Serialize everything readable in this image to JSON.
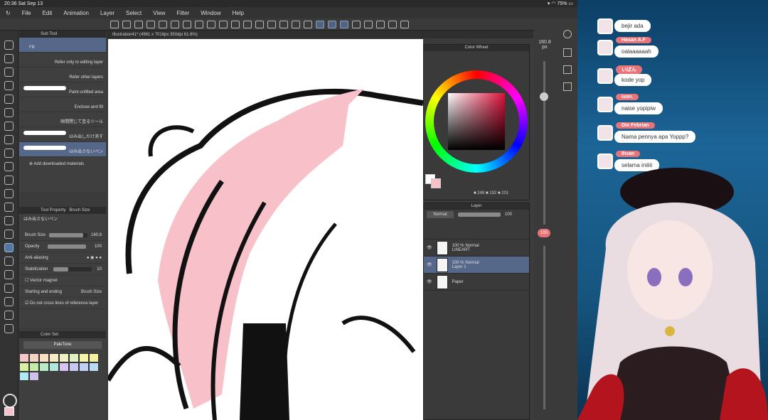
{
  "status": {
    "time": "20:36",
    "date": "Sat Sep 13",
    "battery": "75%"
  },
  "menu": [
    "File",
    "Edit",
    "Animation",
    "Layer",
    "Select",
    "View",
    "Filter",
    "Window",
    "Help"
  ],
  "document": {
    "tab": "Illustration41* (4961 x 7016px 350dpi 61.6%)"
  },
  "subtool": {
    "tab": "Sub Tool",
    "items": [
      "Fill",
      "Refer only to editing layer",
      "Refer other layers",
      "Paint unfilled area",
      "Enclose and fill",
      "隙間閉じて塗るツール",
      "はみ出しだけ消す",
      "はみ出さないペン"
    ],
    "add_materials": "Add downloaded materials"
  },
  "toolprop": {
    "tab1": "Tool Property",
    "tab2": "Brush Size",
    "preset": "はみ出さないペン",
    "brush_size_label": "Brush Size",
    "brush_size": "160.8",
    "opacity_label": "Opacity",
    "opacity": "100",
    "antialias_label": "Anti-aliasing",
    "stabilization_label": "Stabilization",
    "stabilization": "10",
    "vector_magnet": "Vector magnet",
    "start_end_label": "Starting and ending",
    "start_end_value": "Brush Size",
    "no_cross": "Do not cross lines of reference layer"
  },
  "colorset": {
    "tab": "Color Set",
    "name": "PaleTone",
    "swatches": [
      "#f3c7c7",
      "#f6d3c2",
      "#f8e0c0",
      "#f6ecc2",
      "#f1f2c2",
      "#e2f0c2",
      "#f4f5a8",
      "#f3f0a0",
      "#d8f0a4",
      "#c4eca8",
      "#b8ecc6",
      "#b0e8de",
      "#d8c4f2",
      "#c8c8f4",
      "#c0d0f6",
      "#b8dcf6",
      "#b0e8f4",
      "#d0c0ec"
    ]
  },
  "colorwheel": {
    "title": "Color Wheel",
    "r": "248",
    "g": "192",
    "b": "201",
    "main_color": "#f8c0c9"
  },
  "layers": {
    "title": "Layer",
    "blend": "Normal",
    "opacity": "100",
    "rows": [
      {
        "opacity": "100 %",
        "mode": "Normal",
        "name": "LINEART"
      },
      {
        "opacity": "100 %",
        "mode": "Normal",
        "name": "Layer 1"
      },
      {
        "opacity": "",
        "mode": "",
        "name": "Paper"
      }
    ]
  },
  "rightstrip": {
    "size": "160.8",
    "unit": "px",
    "opacity": "100"
  },
  "chat": [
    {
      "name": "",
      "message": "bejir ada"
    },
    {
      "name": "Hasan A.F",
      "message": "oalaaaaaah"
    },
    {
      "name": "いばん",
      "message": "kode yop"
    },
    {
      "name": "ison.",
      "message": "naise yopipiw"
    },
    {
      "name": "Dio Febrian",
      "message": "Nama pennya apa Yoppp?"
    },
    {
      "name": "Ihsan",
      "message": "selama iniiiii"
    }
  ],
  "colors": {
    "accent": "#56688a",
    "chat_name": "#e8747a",
    "hair_pink": "#f8c0c9"
  }
}
